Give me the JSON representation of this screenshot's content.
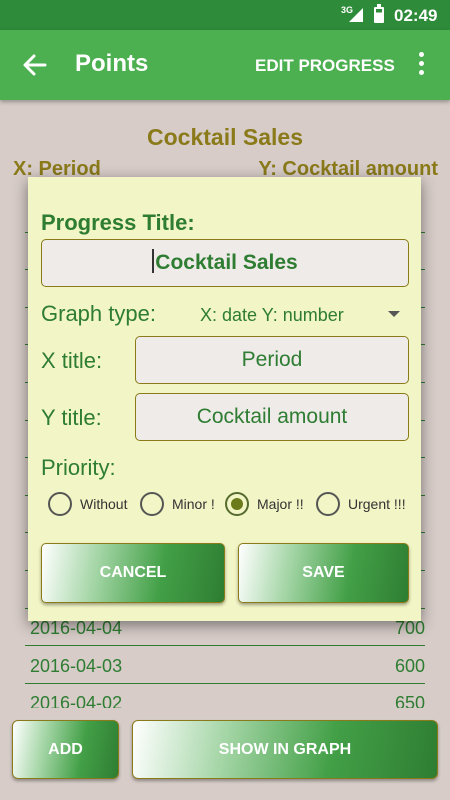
{
  "status_bar": {
    "network": "3G",
    "time": "02:49"
  },
  "toolbar": {
    "title": "Points",
    "edit_label": "EDIT PROGRESS"
  },
  "background": {
    "chart_title": "Cocktail Sales",
    "x_axis": "X: Period",
    "y_axis": "Y: Cocktail amount",
    "rows": [
      {
        "date": "",
        "value": ""
      },
      {
        "date": "",
        "value": ""
      },
      {
        "date": "",
        "value": ""
      },
      {
        "date": "",
        "value": ""
      },
      {
        "date": "",
        "value": ""
      },
      {
        "date": "",
        "value": ""
      },
      {
        "date": "",
        "value": ""
      },
      {
        "date": "",
        "value": ""
      },
      {
        "date": "",
        "value": ""
      },
      {
        "date": "",
        "value": ""
      },
      {
        "date": "",
        "value": ""
      },
      {
        "date": "2016-04-04",
        "value": "700"
      },
      {
        "date": "2016-04-03",
        "value": "600"
      },
      {
        "date": "2016-04-02",
        "value": "650"
      }
    ]
  },
  "buttons": {
    "add": "ADD",
    "show_graph": "SHOW IN GRAPH"
  },
  "dialog": {
    "progress_title_label": "Progress Title:",
    "progress_title_value": "Cocktail Sales",
    "graph_type_label": "Graph type:",
    "graph_type_value": "X: date Y: number",
    "x_title_label": "X title:",
    "x_title_value": "Period",
    "y_title_label": "Y title:",
    "y_title_value": "Cocktail amount",
    "priority_label": "Priority:",
    "priorities": [
      {
        "label": "Without",
        "selected": false
      },
      {
        "label": "Minor !",
        "selected": false
      },
      {
        "label": "Major !!",
        "selected": true
      },
      {
        "label": "Urgent !!!",
        "selected": false
      }
    ],
    "cancel_label": "CANCEL",
    "save_label": "SAVE"
  },
  "colors": {
    "primary": "#4caf50",
    "status_bar": "#2e8b3a",
    "text_green": "#2e7d32",
    "olive": "#8a7a1a",
    "dialog_bg": "#f2f5c5",
    "page_bg": "#d7ccc8"
  }
}
